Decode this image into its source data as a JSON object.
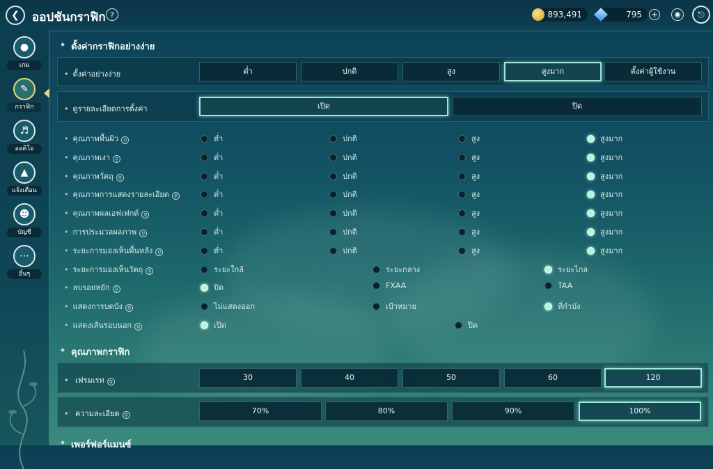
{
  "header": {
    "title": "ออปชันกราฟิก",
    "help_icon": "?",
    "gold": "893,491",
    "gems": "795",
    "plus_icon": "+"
  },
  "sidebar": {
    "items": [
      {
        "label": "เกม",
        "icon": "gamepad-icon"
      },
      {
        "label": "กราฟิก",
        "icon": "palette-icon",
        "active": true
      },
      {
        "label": "ออดิโอ",
        "icon": "speaker-icon"
      },
      {
        "label": "แจ้งเตือน",
        "icon": "bell-icon"
      },
      {
        "label": "บัญชี",
        "icon": "user-icon"
      },
      {
        "label": "อื่นๆ",
        "icon": "more-icon"
      }
    ]
  },
  "simple": {
    "section_title": "ตั้งค่ากราฟิกอย่างง่าย",
    "preset_label": "ตั้งค่าอย่างง่าย",
    "presets": [
      "ต่ำ",
      "ปกติ",
      "สูง",
      "สูงมาก",
      "ตั้งค่าผู้ใช้งาน"
    ],
    "preset_selected": "สูงมาก",
    "detail_label": "ดูรายละเอียดการตั้งค่า",
    "detail_options": [
      "เปิด",
      "ปิด"
    ],
    "detail_selected": "เปิด"
  },
  "rows": [
    {
      "label": "คุณภาพพื้นผิว",
      "options": [
        "ต่ำ",
        "ปกติ",
        "สูง",
        "สูงมาก"
      ],
      "selected": 3
    },
    {
      "label": "คุณภาพเงา",
      "options": [
        "ต่ำ",
        "ปกติ",
        "สูง",
        "สูงมาก"
      ],
      "selected": 3
    },
    {
      "label": "คุณภาพวัตถุ",
      "options": [
        "ต่ำ",
        "ปกติ",
        "สูง",
        "สูงมาก"
      ],
      "selected": 3
    },
    {
      "label": "คุณภาพการแสดงรายละเอียด",
      "options": [
        "ต่ำ",
        "ปกติ",
        "สูง",
        "สูงมาก"
      ],
      "selected": 3
    },
    {
      "label": "คุณภาพผลเอฟเฟกต์",
      "options": [
        "ต่ำ",
        "ปกติ",
        "สูง",
        "สูงมาก"
      ],
      "selected": 3
    },
    {
      "label": "การประมวลผลภาพ",
      "options": [
        "ต่ำ",
        "ปกติ",
        "สูง",
        "สูงมาก"
      ],
      "selected": 3
    },
    {
      "label": "ระยะการมองเห็นพื้นหลัง",
      "options": [
        "ต่ำ",
        "ปกติ",
        "สูง",
        "สูงมาก"
      ],
      "selected": 3
    },
    {
      "label": "ระยะการมองเห็นวัตถุ",
      "options": [
        "ระยะใกล้",
        "ระยะกลาง",
        "ระยะไกล"
      ],
      "selected": 2
    },
    {
      "label": "ลบรอยหยัก",
      "options": [
        "ปิด",
        "FXAA",
        "TAA"
      ],
      "selected": 0
    },
    {
      "label": "แสดงการบดบัง",
      "options": [
        "ไม่แสดงออก",
        "เป้าหมาย",
        "ที่กำบัง"
      ],
      "selected": 2
    },
    {
      "label": "แสดงเส้นรอบนอก",
      "options": [
        "เปิด",
        "ปิด"
      ],
      "selected": 0
    }
  ],
  "quality": {
    "section_title": "คุณภาพกราฟิก",
    "fps_label": "เฟรมเรท",
    "fps_options": [
      "30",
      "40",
      "50",
      "60",
      "120"
    ],
    "fps_selected": "120",
    "res_label": "ความละเอียด",
    "res_options": [
      "70%",
      "80%",
      "90%",
      "100%"
    ],
    "res_selected": "100%"
  },
  "performance": {
    "section_title": "เพอร์ฟอร์แมนซ์"
  }
}
